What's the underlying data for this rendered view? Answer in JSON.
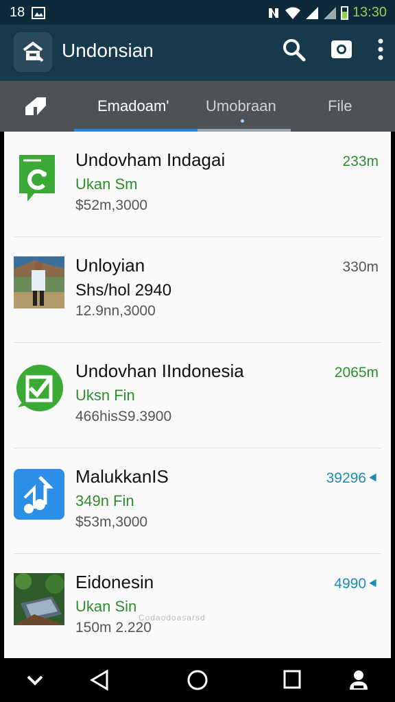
{
  "status_bar": {
    "left_number": "18",
    "time": "13:30"
  },
  "app_bar": {
    "title": "Undonsian",
    "icons": [
      "store-icon",
      "search-icon",
      "camera-icon",
      "more-vert-icon"
    ]
  },
  "tabs": [
    {
      "label": "Emadoam'",
      "active": true
    },
    {
      "label": "Umobraan",
      "active": false
    },
    {
      "label": "File",
      "active": false
    }
  ],
  "items": [
    {
      "title": "Undovham Indagai",
      "subtitle": "Ukan Sm",
      "meta": "$52m,3000",
      "right": "233m",
      "thumb": "green-chat-icon"
    },
    {
      "title": "Unloyian",
      "subtitle": "Shs/hol 2940",
      "meta": "12.9nn,3000",
      "right": "330m",
      "thumb": "photo-thumbnail"
    },
    {
      "title": "Undovhan IIndonesia",
      "subtitle": "Uksn Fin",
      "meta": "466hisS9.3900",
      "right": "2065m",
      "thumb": "whatsapp-icon"
    },
    {
      "title": "MalukkanIS",
      "subtitle": "349n Fin",
      "meta": "$53m,3000",
      "right": "39296",
      "thumb": "music-icon"
    },
    {
      "title": "Eidonesin",
      "subtitle": "Ukan Sin",
      "meta": "150m 2.220",
      "right": "4990",
      "thumb": "photo-thumbnail"
    }
  ],
  "watermark": "Codaodoasarsd",
  "colors": {
    "status_bar": "#0c2a3a",
    "app_bar": "#163a4b",
    "tab_bar": "#4e5257",
    "accent_blue": "#1e88e5",
    "green": "#2e8b2e",
    "teal": "#1b8ab5"
  }
}
